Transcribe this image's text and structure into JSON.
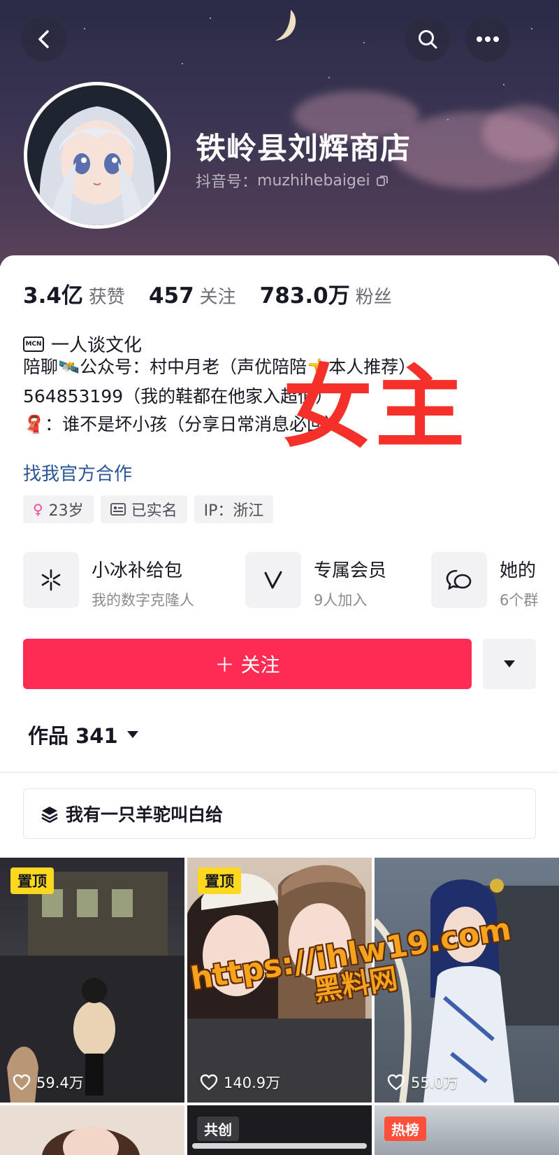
{
  "header": {
    "profile_name": "铁岭县刘辉商店",
    "douyin_id_label": "抖音号：",
    "douyin_id": "muzhihebaigei"
  },
  "stats": [
    {
      "value": "3.4亿",
      "label": "获赞"
    },
    {
      "value": "457",
      "label": "关注"
    },
    {
      "value": "783.0万",
      "label": "粉丝"
    }
  ],
  "mcn": {
    "badge": "MCN",
    "name": "一人谈文化"
  },
  "bio": {
    "line1": "陪聊🛰️公众号：村中月老（声优陪陪👈本人推荐）",
    "line2": "564853199（我的鞋都在他家入超值）",
    "line3": "🧣：谁不是坏小孩（分享日常消息必回）",
    "link": "找我官方合作"
  },
  "tags": [
    {
      "icon": "female-icon",
      "text": "23岁"
    },
    {
      "icon": "id-card-icon",
      "text": "已实名"
    },
    {
      "icon": "",
      "text": "IP：浙江"
    }
  ],
  "services": [
    {
      "icon": "xiaobing-icon",
      "title": "小冰补给包",
      "subtitle": "我的数字克隆人"
    },
    {
      "icon": "v-member-icon",
      "title": "专属会员",
      "subtitle": "9人加入"
    },
    {
      "icon": "chat-group-icon",
      "title": "她的",
      "subtitle": "6个群"
    }
  ],
  "actions": {
    "follow_label": "＋ 关注"
  },
  "works": {
    "tab_label": "作品 341",
    "collection_label": "我有一只羊驼叫白给"
  },
  "videos": [
    {
      "pin": "置顶",
      "likes": "59.4万"
    },
    {
      "pin": "置顶",
      "likes": "140.9万"
    },
    {
      "pin": "",
      "likes": "55.0万"
    },
    {
      "badge": "",
      "likes": ""
    },
    {
      "badge": "共创",
      "likes": ""
    },
    {
      "badge": "热榜",
      "likes": ""
    }
  ],
  "overlays": {
    "red_text": "女主",
    "watermark_url": "https://ihlw19.com",
    "watermark_cn": "黑料网"
  },
  "colors": {
    "accent": "#fe2c55",
    "link": "#2b5597",
    "pin": "#fdd81f"
  }
}
